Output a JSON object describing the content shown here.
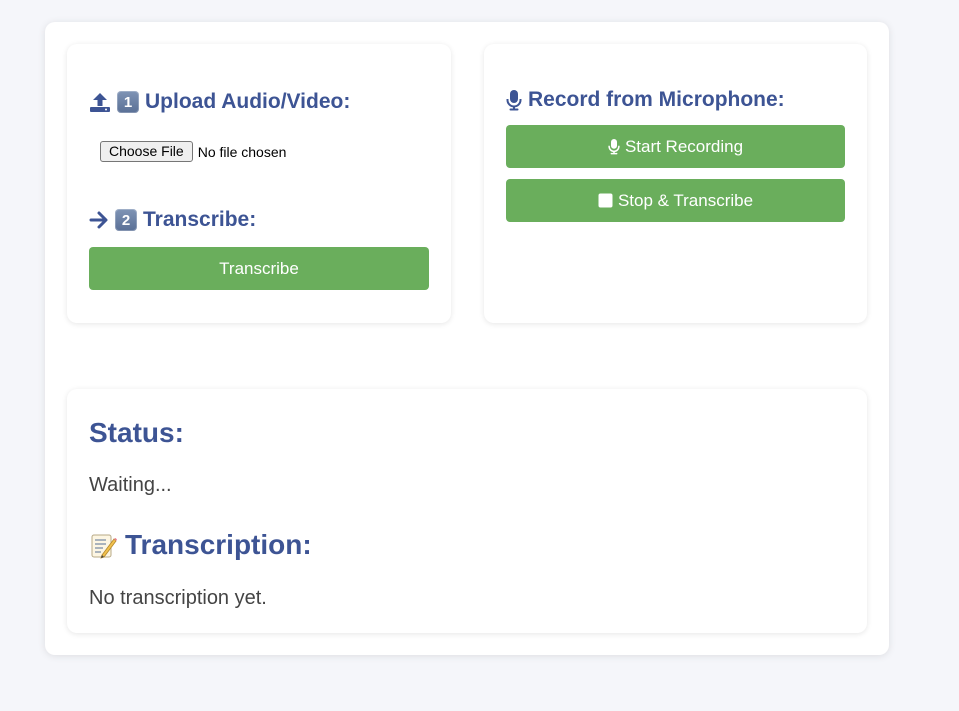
{
  "upload": {
    "heading": "Upload Audio/Video:",
    "step_badge": "1",
    "icon": "upload-icon",
    "file_button_label": "Choose File",
    "file_status": "No file chosen"
  },
  "transcribe": {
    "heading": "Transcribe:",
    "step_badge": "2",
    "icon": "arrow-right-icon",
    "button_label": "Transcribe"
  },
  "record": {
    "heading": "Record from Microphone:",
    "icon": "microphone-icon",
    "start_label": "Start Recording",
    "stop_label": "Stop & Transcribe",
    "stop_icon": "stop-icon"
  },
  "status": {
    "heading": "Status:",
    "value": "Waiting..."
  },
  "transcription": {
    "heading": "Transcription:",
    "icon": "memo-icon",
    "value": "No transcription yet."
  },
  "colors": {
    "accent": "#3d5494",
    "button": "#6aae5c",
    "background": "#f5f6fa"
  }
}
